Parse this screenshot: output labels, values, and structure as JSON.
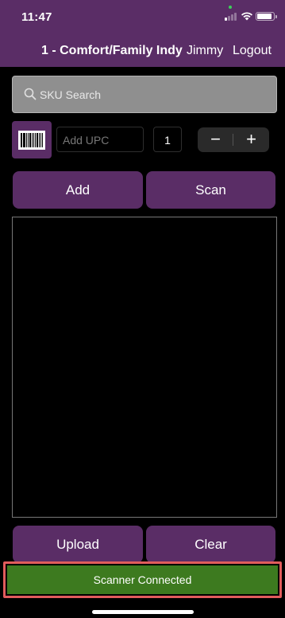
{
  "status_bar": {
    "time": "11:47"
  },
  "header": {
    "title": "1 - Comfort/Family Indy",
    "user": "Jimmy",
    "logout_label": "Logout"
  },
  "search": {
    "placeholder": "SKU Search"
  },
  "upc": {
    "placeholder": "Add UPC",
    "quantity": "1"
  },
  "stepper": {
    "minus": "−",
    "plus": "+"
  },
  "actions": {
    "add_label": "Add",
    "scan_label": "Scan",
    "upload_label": "Upload",
    "clear_label": "Clear"
  },
  "scanner": {
    "status_text": "Scanner Connected"
  },
  "colors": {
    "header_bg": "#5a2d66",
    "button_bg": "#5a2d66",
    "status_green": "#3d7a1f",
    "highlight_border": "#e15c5c"
  }
}
